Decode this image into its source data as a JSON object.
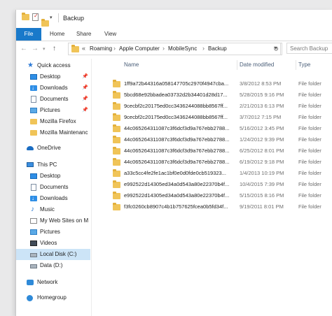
{
  "window": {
    "title": "Backup"
  },
  "ribbon": {
    "tabs": [
      "File",
      "Home",
      "Share",
      "View"
    ]
  },
  "address": {
    "crumbs": [
      "Roaming",
      "Apple Computer",
      "MobileSync",
      "Backup"
    ],
    "overflow": "«"
  },
  "search": {
    "placeholder": "Search Backup"
  },
  "nav": {
    "quick_access": "Quick access",
    "items": [
      {
        "label": "Desktop",
        "icon": "desktop-icon"
      },
      {
        "label": "Downloads",
        "icon": "downloads-icon"
      },
      {
        "label": "Documents",
        "icon": "documents-icon"
      },
      {
        "label": "Pictures",
        "icon": "pictures-icon"
      },
      {
        "label": "Mozilla Firefox",
        "icon": "folder-icon"
      },
      {
        "label": "Mozilla Maintenanc",
        "icon": "folder-icon"
      }
    ],
    "onedrive": "OneDrive",
    "this_pc": "This PC",
    "pc_items": [
      {
        "label": "Desktop",
        "icon": "desktop-icon"
      },
      {
        "label": "Documents",
        "icon": "documents-icon"
      },
      {
        "label": "Downloads",
        "icon": "downloads-icon"
      },
      {
        "label": "Music",
        "icon": "music-icon"
      },
      {
        "label": "My Web Sites on M",
        "icon": "web-sites-icon"
      },
      {
        "label": "Pictures",
        "icon": "pictures-icon"
      },
      {
        "label": "Videos",
        "icon": "videos-icon"
      },
      {
        "label": "Local Disk (C:)",
        "icon": "local-disk-icon"
      },
      {
        "label": "Data (D:)",
        "icon": "data-disk-icon"
      }
    ],
    "network": "Network",
    "homegroup": "Homegroup"
  },
  "columns": {
    "name": "Name",
    "date": "Date modified",
    "type": "Type"
  },
  "files": [
    {
      "name": "1ff9a72b44316a058147705c2970f4947cba...",
      "date": "3/8/2012 8:53 PM",
      "type": "File folder"
    },
    {
      "name": "5bcd68e92bbadea03732d2b34401d28d17...",
      "date": "5/28/2015 9:16 PM",
      "type": "File folder"
    },
    {
      "name": "9cecbf2c20175ed0cc3436244088bb8567ff...",
      "date": "2/21/2013 6:13 PM",
      "type": "File folder"
    },
    {
      "name": "9cecbf2c20175ed0cc3436244088bb8567ff...",
      "date": "3/7/2012 7:15 PM",
      "type": "File folder"
    },
    {
      "name": "44c065264311087c3f6dcf3d9a767ebb2788...",
      "date": "5/16/2012 3:45 PM",
      "type": "File folder"
    },
    {
      "name": "44c065264311087c3f6dcf3d9a767ebb2788...",
      "date": "1/24/2012 9:39 PM",
      "type": "File folder"
    },
    {
      "name": "44c065264311087c3f6dcf3d9a767ebb2788...",
      "date": "6/25/2012 8:01 PM",
      "type": "File folder"
    },
    {
      "name": "44c065264311087c3f6dcf3d9a767ebb2788...",
      "date": "6/19/2012 9:18 PM",
      "type": "File folder"
    },
    {
      "name": "a33c5cc4fe2fe1ac1bf0e0d0fde0cb519323...",
      "date": "1/4/2013 10:19 PM",
      "type": "File folder"
    },
    {
      "name": "e992522d14305ed34a0d543a80e22370b4f...",
      "date": "10/4/2015 7:39 PM",
      "type": "File folder"
    },
    {
      "name": "e992522d14305ed34a0d543a80e22370b4f...",
      "date": "5/15/2015 8:16 PM",
      "type": "File folder"
    },
    {
      "name": "f3fc0260cb8907c4b1b757625fcea0b5fd34f...",
      "date": "9/19/2011 8:01 PM",
      "type": "File folder"
    }
  ]
}
